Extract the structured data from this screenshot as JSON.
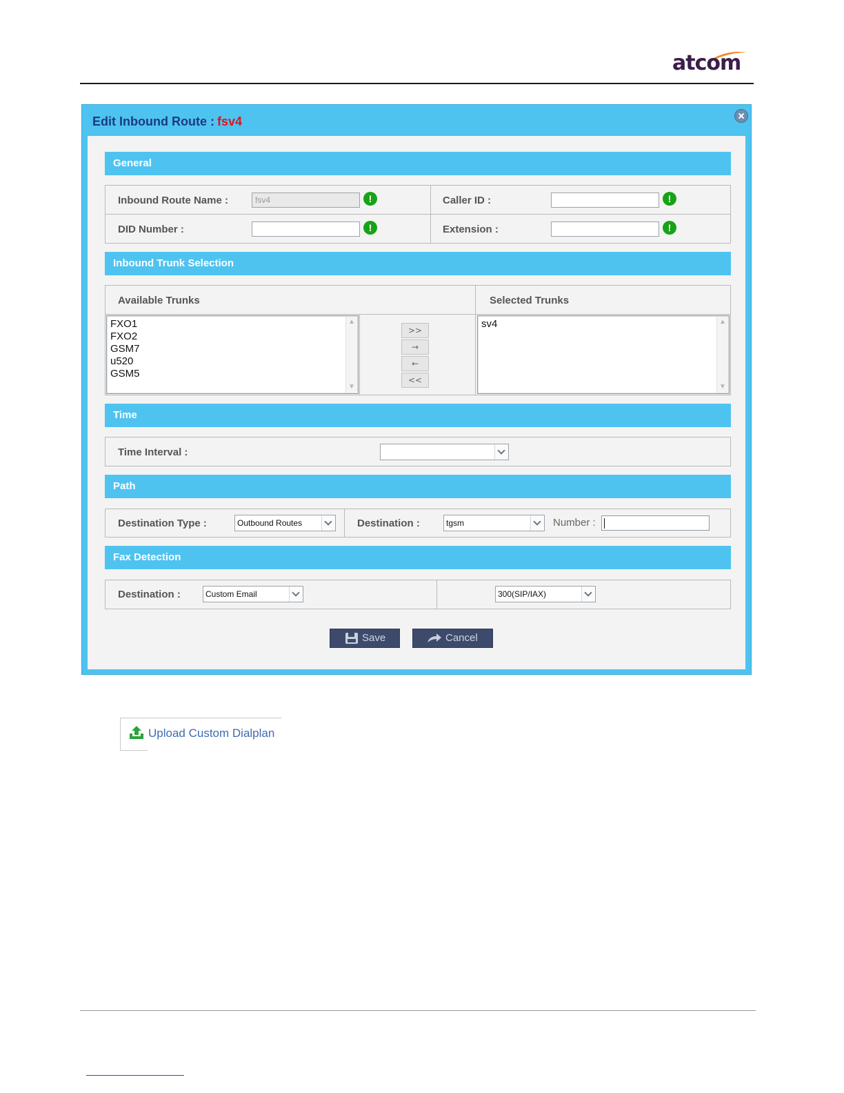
{
  "logo": {
    "text": "atcom",
    "swoosh_color": "#f08a24",
    "text_color": "#3b1d4a"
  },
  "dialog": {
    "title": "Edit Inbound Route :",
    "route_name": "fsv4",
    "close_icon": "close-circle-icon"
  },
  "sections": {
    "general": "General",
    "trunks": "Inbound Trunk Selection",
    "time": "Time",
    "path": "Path",
    "fax": "Fax Detection"
  },
  "general": {
    "route_name_label": "Inbound Route Name :",
    "route_name_value": "fsv4",
    "caller_id_label": "Caller ID :",
    "caller_id_value": "",
    "did_label": "DID Number :",
    "did_value": "",
    "extension_label": "Extension :",
    "extension_value": "",
    "warn_glyph": "!"
  },
  "trunks": {
    "available_label": "Available Trunks",
    "selected_label": "Selected Trunks",
    "available": [
      "FXO1",
      "FXO2",
      "GSM7",
      "u520",
      "GSM5"
    ],
    "selected": [
      "sv4"
    ],
    "buttons": {
      "add_all": ">>",
      "add": "→",
      "remove": "←",
      "remove_all": "<<"
    }
  },
  "time": {
    "interval_label": "Time Interval :",
    "interval_value": ""
  },
  "path": {
    "dest_type_label": "Destination Type :",
    "dest_type_value": "Outbound Routes",
    "destination_label": "Destination :",
    "destination_value": "tgsm",
    "number_label": "Number :",
    "number_value": ""
  },
  "fax": {
    "destination_label": "Destination :",
    "destination_value": "Custom Email",
    "extension_value": "300(SIP/IAX)"
  },
  "actions": {
    "save": "Save",
    "cancel": "Cancel"
  },
  "upload": {
    "label": "Upload Custom Dialplan",
    "icon": "upload-cloud-icon"
  },
  "colors": {
    "dialog_frame": "#4fc3f0",
    "title_text": "#1c3a82",
    "route_name": "#e2131b",
    "button": "#3d4a6b",
    "warn": "#17a317",
    "link": "#3e6bb3"
  }
}
